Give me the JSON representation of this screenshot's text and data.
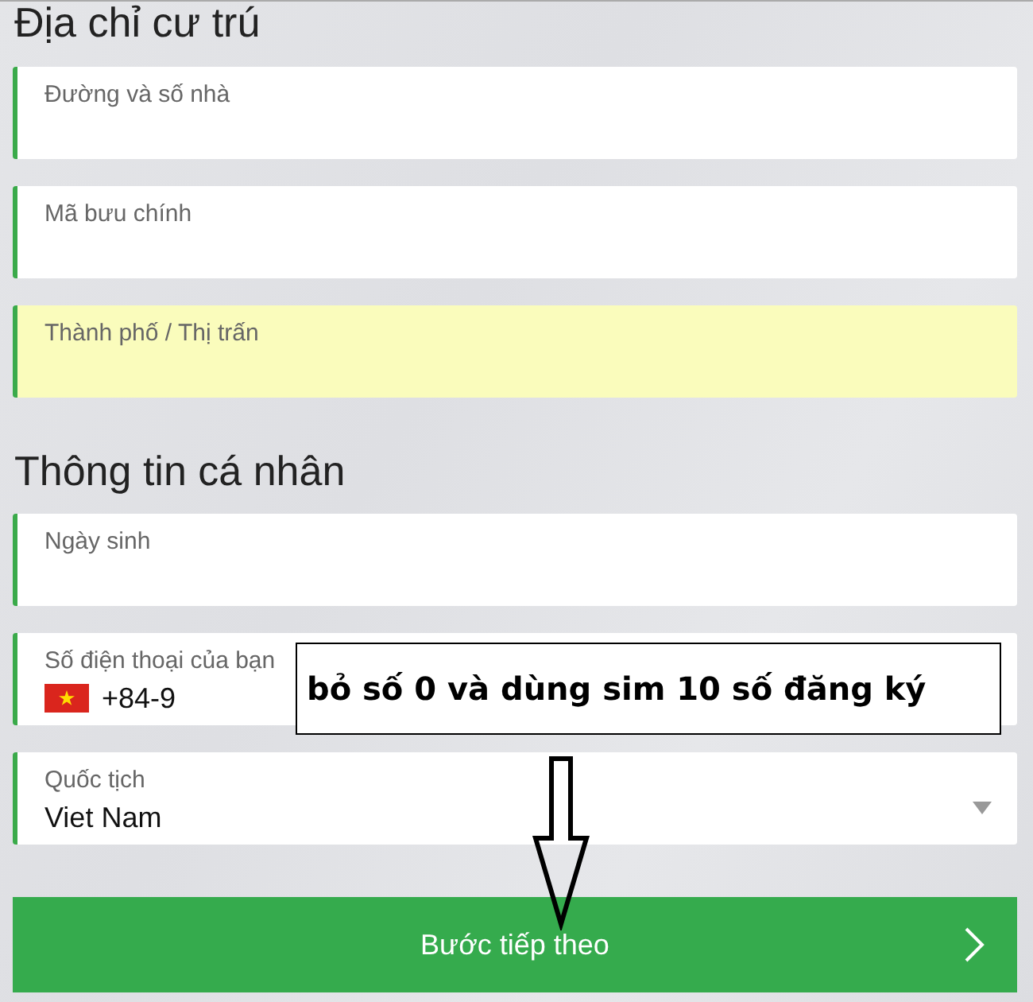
{
  "sections": [
    {
      "heading": "Địa chỉ cư trú",
      "fields": [
        {
          "kind": "text",
          "label": "Đường và số nhà",
          "highlighted": false
        },
        {
          "kind": "text",
          "label": "Mã bưu chính",
          "highlighted": false
        },
        {
          "kind": "text",
          "label": "Thành phố / Thị trấn",
          "highlighted": true
        }
      ]
    },
    {
      "heading": "Thông tin cá nhân",
      "fields": [
        {
          "kind": "text",
          "label": "Ngày sinh",
          "highlighted": false
        },
        {
          "kind": "phone",
          "label": "Số điện thoại của bạn",
          "value": "+84-9",
          "highlighted": false
        },
        {
          "kind": "select",
          "label": "Quốc tịch",
          "value": "Viet Nam",
          "highlighted": false
        }
      ]
    }
  ],
  "annotation": {
    "text": "bỏ số 0 và dùng sim 10 số đăng ký"
  },
  "next_button": {
    "label": "Bước tiếp theo"
  }
}
